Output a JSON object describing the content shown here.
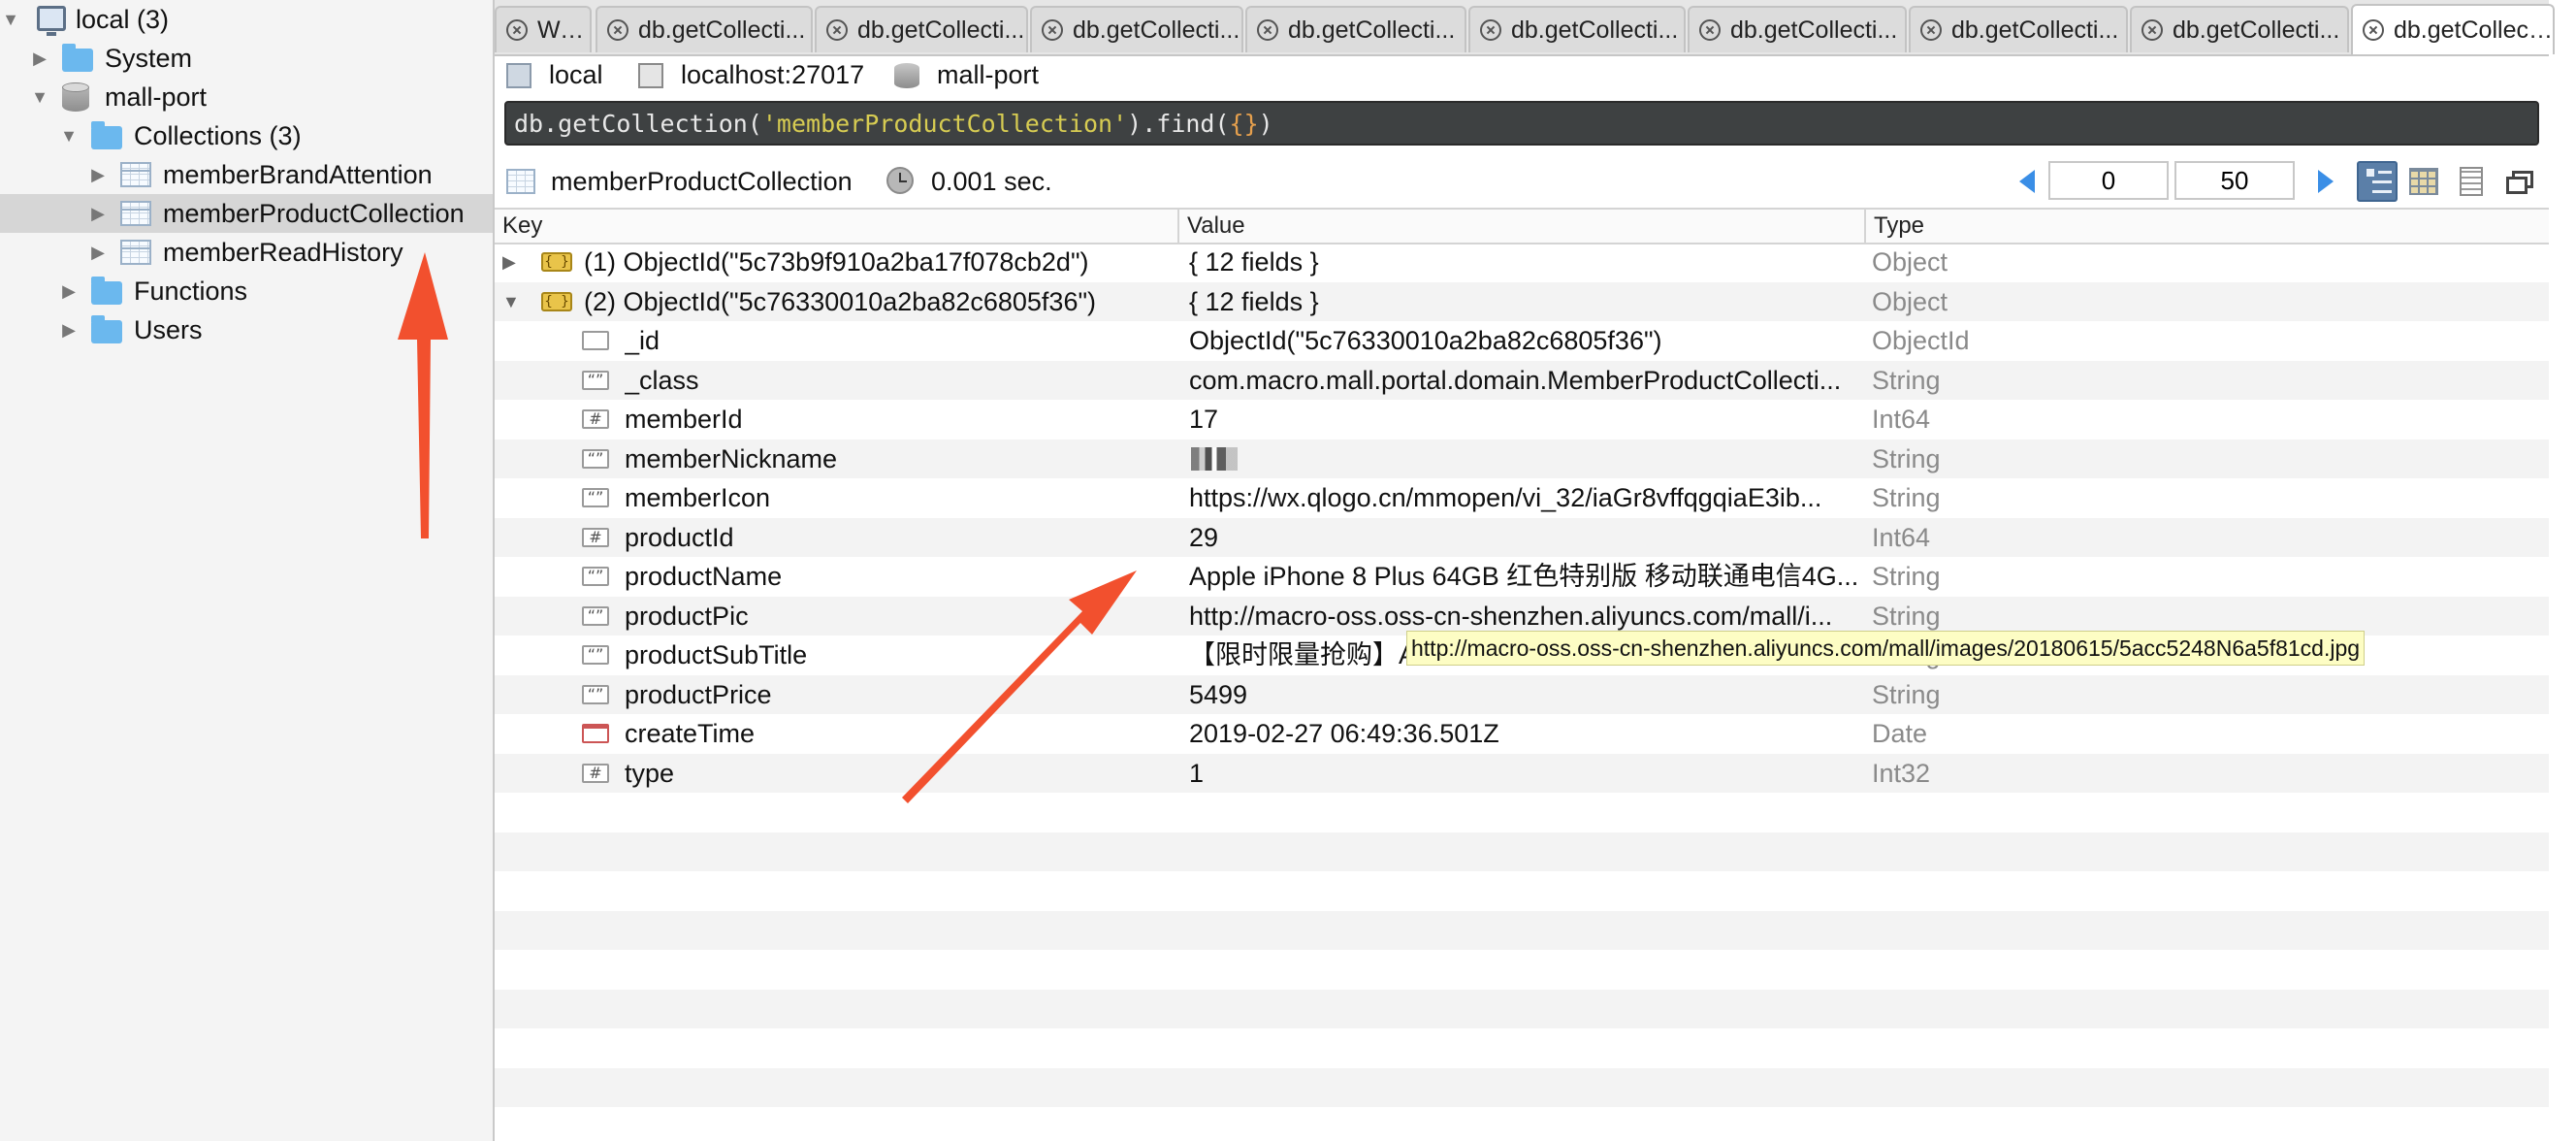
{
  "sidebar": {
    "items": [
      {
        "label": "local (3)",
        "icon": "computer-icon",
        "expanded": true
      },
      {
        "label": "System",
        "icon": "folder-icon",
        "expanded": false
      },
      {
        "label": "mall-port",
        "icon": "database-icon",
        "expanded": true
      },
      {
        "label": "Collections (3)",
        "icon": "folder-icon",
        "expanded": true
      },
      {
        "label": "memberBrandAttention",
        "icon": "collection-icon",
        "expanded": false
      },
      {
        "label": "memberProductCollection",
        "icon": "collection-icon",
        "expanded": false,
        "selected": true
      },
      {
        "label": "memberReadHistory",
        "icon": "collection-icon",
        "expanded": false
      },
      {
        "label": "Functions",
        "icon": "folder-icon",
        "expanded": false
      },
      {
        "label": "Users",
        "icon": "folder-icon",
        "expanded": false
      }
    ]
  },
  "tabs": [
    {
      "label": "Wel..."
    },
    {
      "label": "db.getCollecti..."
    },
    {
      "label": "db.getCollecti..."
    },
    {
      "label": "db.getCollecti..."
    },
    {
      "label": "db.getCollecti..."
    },
    {
      "label": "db.getCollecti..."
    },
    {
      "label": "db.getCollecti..."
    },
    {
      "label": "db.getCollecti..."
    },
    {
      "label": "db.getCollecti..."
    },
    {
      "label": "db.getCollecti...",
      "active": true
    }
  ],
  "connection": {
    "connection_name": "local",
    "server": "localhost:27017",
    "database": "mall-port"
  },
  "query": {
    "prefix": "db.getCollection(",
    "collection_literal": "'memberProductCollection'",
    "middle": ").find(",
    "argument": "{}",
    "suffix": ")"
  },
  "result_toolbar": {
    "collection": "memberProductCollection",
    "exec_time": "0.001 sec.",
    "skip": "0",
    "limit": "50"
  },
  "grid": {
    "columns": [
      "Key",
      "Value",
      "Type"
    ],
    "rows": [
      {
        "key": "(1) ObjectId(\"5c73b9f910a2ba17f078cb2d\")",
        "value": "{ 12 fields }",
        "type": "Object",
        "level": 0,
        "expanded": false,
        "icon": "object-icon"
      },
      {
        "key": "(2) ObjectId(\"5c76330010a2ba82c6805f36\")",
        "value": "{ 12 fields }",
        "type": "Object",
        "level": 0,
        "expanded": true,
        "icon": "object-icon"
      },
      {
        "key": "_id",
        "value": "ObjectId(\"5c76330010a2ba82c6805f36\")",
        "type": "ObjectId",
        "level": 1,
        "icon": "objectid-icon"
      },
      {
        "key": "_class",
        "value": "com.macro.mall.portal.domain.MemberProductCollecti...",
        "type": "String",
        "level": 1,
        "icon": "string-icon"
      },
      {
        "key": "memberId",
        "value": "17",
        "type": "Int64",
        "level": 1,
        "icon": "number-icon"
      },
      {
        "key": "memberNickname",
        "value": "",
        "type": "String",
        "level": 1,
        "icon": "string-icon"
      },
      {
        "key": "memberIcon",
        "value": "https://wx.qlogo.cn/mmopen/vi_32/iaGr8vffqgqiaE3ib...",
        "type": "String",
        "level": 1,
        "icon": "string-icon"
      },
      {
        "key": "productId",
        "value": "29",
        "type": "Int64",
        "level": 1,
        "icon": "number-icon"
      },
      {
        "key": "productName",
        "value": "Apple iPhone 8 Plus 64GB 红色特别版 移动联通电信4G...",
        "type": "String",
        "level": 1,
        "icon": "string-icon"
      },
      {
        "key": "productPic",
        "value": "http://macro-oss.oss-cn-shenzhen.aliyuncs.com/mall/i...",
        "type": "String",
        "level": 1,
        "icon": "string-icon"
      },
      {
        "key": "productSubTitle",
        "value": "【限时限量抢购】A",
        "type": "String",
        "level": 1,
        "icon": "string-icon"
      },
      {
        "key": "productPrice",
        "value": "5499",
        "type": "String",
        "level": 1,
        "icon": "string-icon"
      },
      {
        "key": "createTime",
        "value": "2019-02-27 06:49:36.501Z",
        "type": "Date",
        "level": 1,
        "icon": "date-icon"
      },
      {
        "key": "type",
        "value": "1",
        "type": "Int32",
        "level": 1,
        "icon": "number-icon"
      }
    ]
  },
  "tooltip": {
    "text": "http://macro-oss.oss-cn-shenzhen.aliyuncs.com/mall/images/20180615/5acc5248N6a5f81cd.jpg"
  },
  "colors": {
    "annotation_arrow": "#f2502e",
    "selected_row": "#d6d6d6",
    "query_bg": "#3e4142",
    "query_string": "#d7cc52"
  }
}
